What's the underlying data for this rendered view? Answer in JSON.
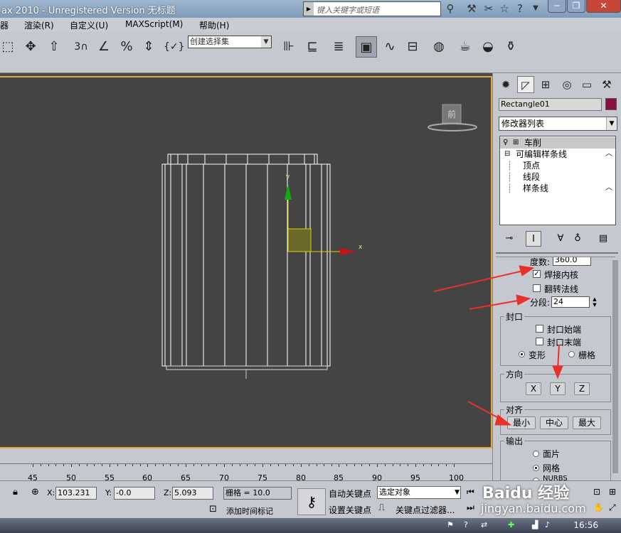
{
  "app": {
    "title": "ax  2010  - Unregistered Version      无标题",
    "search_placeholder": "键入关键字或短语"
  },
  "menu": [
    "器",
    "渲染(R)",
    "自定义(U)",
    "MAXScript(M)",
    "帮助(H)"
  ],
  "toolbar": {
    "selection_set_placeholder": "创建选择集",
    "snap_label": "3",
    "icons": [
      "move-icon",
      "snap-3d-icon",
      "angle-snap-icon",
      "percent-snap-icon",
      "spinner-snap-icon",
      "edit-named-sel-icon",
      "mirror-icon",
      "align-icon",
      "layer-icon",
      "scene-explorer-icon",
      "curve-editor-icon",
      "schematic-icon",
      "material-editor-icon",
      "render-setup-icon",
      "render-frame-icon",
      "render-icon"
    ]
  },
  "viewport": {
    "label": "前",
    "gizmo_x": "x",
    "gizmo_y": "y",
    "colors": {
      "background": "#444444",
      "border": "#e3a83d",
      "mesh": "#ffffff",
      "x_axis": "#cc1111",
      "y_axis": "#11aa11",
      "gizmo": "#ffff00"
    }
  },
  "command_panel": {
    "tabs": [
      "create-icon",
      "modify-icon",
      "hierarchy-icon",
      "motion-icon",
      "display-icon",
      "utilities-icon"
    ],
    "object_name": "Rectangle01",
    "object_color": "#8b1040",
    "modifier_list": "修改器列表",
    "stack": [
      {
        "label": "车削",
        "level": 0
      },
      {
        "label": "可编辑样条线",
        "level": 0
      },
      {
        "label": "顶点",
        "level": 1
      },
      {
        "label": "线段",
        "level": 1
      },
      {
        "label": "样条线",
        "level": 1
      }
    ],
    "parameters": {
      "degrees_label": "度数:",
      "degrees_value": "360.0",
      "weld_core": "焊接内核",
      "flip_normals": "翻转法线",
      "segments_label": "分段:",
      "segments_value": "24",
      "cap_group": "封口",
      "cap_start": "封口始端",
      "cap_end": "封口末端",
      "morph": "变形",
      "grid": "栅格",
      "direction_group": "方向",
      "dir_x": "X",
      "dir_y": "Y",
      "dir_z": "Z",
      "align_group": "对齐",
      "align_min": "最小",
      "align_center": "中心",
      "align_max": "最大",
      "output_group": "输出",
      "output_patch": "面片",
      "output_mesh": "网格",
      "output_nurbs": "NURBS"
    }
  },
  "timeline": {
    "ticks": [
      "45",
      "50",
      "55",
      "60",
      "65",
      "70",
      "75",
      "80",
      "85",
      "90",
      "95",
      "100"
    ]
  },
  "statusbar": {
    "x_label": "X:",
    "x_value": "103.231",
    "y_label": "Y:",
    "y_value": "-0.0",
    "z_label": "Z:",
    "z_value": "5.093",
    "grid": "栅格 = 10.0",
    "auto_key": "自动关键点",
    "selected": "选定对象",
    "set_key": "设置关键点",
    "key_filters": "关键点过滤器...",
    "add_time_tag": "添加时间标记"
  },
  "watermark": {
    "line1": "Baidu 经验",
    "line2": "jingyan.baidu.com"
  },
  "taskbar": {
    "clock": "16:56"
  }
}
